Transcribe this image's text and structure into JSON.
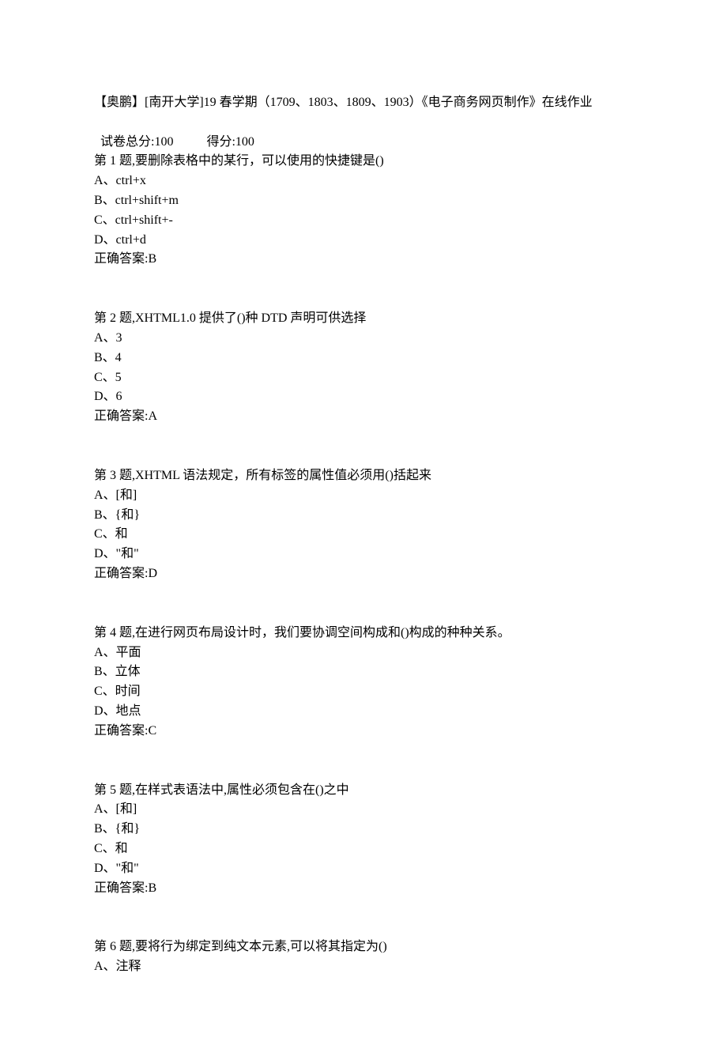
{
  "header": {
    "title": "【奥鹏】[南开大学]19 春学期（1709、1803、1809、1903）《电子商务网页制作》在线作业",
    "score_total_label": "试卷总分:100",
    "score_got_label": "得分:100"
  },
  "questions": [
    {
      "prompt": "第 1 题,要删除表格中的某行，可以使用的快捷键是()",
      "options": [
        "A、ctrl+x",
        "B、ctrl+shift+m",
        "C、ctrl+shift+-",
        "D、ctrl+d"
      ],
      "answer": "正确答案:B"
    },
    {
      "prompt": "第 2 题,XHTML1.0 提供了()种 DTD 声明可供选择",
      "options": [
        "A、3",
        "B、4",
        "C、5",
        "D、6"
      ],
      "answer": "正确答案:A"
    },
    {
      "prompt": "第 3 题,XHTML 语法规定，所有标签的属性值必须用()括起来",
      "options": [
        "A、[和]",
        "B、{和}",
        "C、和",
        "D、\"和\""
      ],
      "answer": "正确答案:D"
    },
    {
      "prompt": "第 4 题,在进行网页布局设计时，我们要协调空间构成和()构成的种种关系。",
      "options": [
        "A、平面",
        "B、立体",
        "C、时间",
        "D、地点"
      ],
      "answer": "正确答案:C"
    },
    {
      "prompt": "第 5 题,在样式表语法中,属性必须包含在()之中",
      "options": [
        "A、[和]",
        "B、{和}",
        "C、和",
        "D、\"和\""
      ],
      "answer": "正确答案:B"
    },
    {
      "prompt": "第 6 题,要将行为绑定到纯文本元素,可以将其指定为()",
      "options": [
        "A、注释"
      ],
      "answer": ""
    }
  ]
}
